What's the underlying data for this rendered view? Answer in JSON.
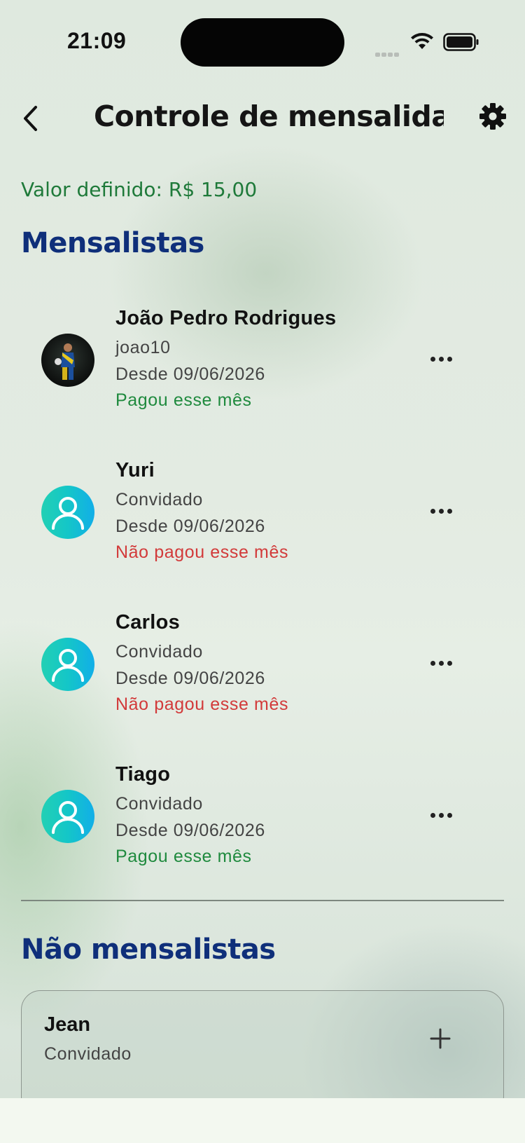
{
  "status_bar": {
    "time": "21:09"
  },
  "header": {
    "title": "Controle de mensalida…",
    "back_icon": "chevron-left-icon",
    "settings_icon": "gear-icon"
  },
  "valor_definido": "Valor definido: R$ 15,00",
  "mensalistas": {
    "title": "Mensalistas",
    "items": [
      {
        "name": "João Pedro Rodrigues",
        "subtitle": "joao10",
        "since": "Desde 09/06/2026",
        "status": "Pagou esse mês",
        "avatar": "photo"
      },
      {
        "name": "Yuri",
        "subtitle": "Convidado",
        "since": "Desde 09/06/2026",
        "status": "Não pagou esse mês",
        "avatar": "default-user"
      },
      {
        "name": "Carlos",
        "subtitle": "Convidado",
        "since": "Desde 09/06/2026",
        "status": "Não pagou esse mês",
        "avatar": "default-user"
      },
      {
        "name": "Tiago",
        "subtitle": "Convidado",
        "since": "Desde 09/06/2026",
        "status": "Pagou esse mês",
        "avatar": "default-user"
      }
    ]
  },
  "nao_mensalistas": {
    "title": "Não mensalistas",
    "items": [
      {
        "name": "Jean",
        "subtitle": "Convidado"
      }
    ]
  },
  "colors": {
    "paid": "#1f8a3e",
    "unpaid": "#d23a3a",
    "section_title": "#0f2f7a",
    "valor": "#1f7a3a"
  }
}
